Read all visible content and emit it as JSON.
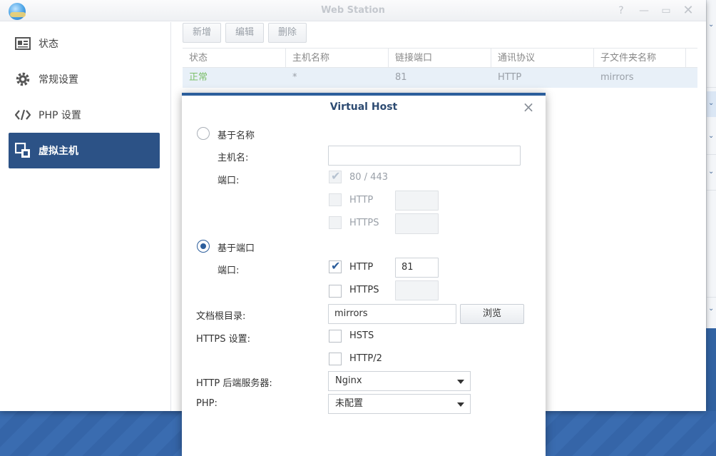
{
  "window": {
    "title": "Web Station"
  },
  "sidebar": {
    "items": [
      {
        "label": "状态",
        "icon": "status-icon"
      },
      {
        "label": "常规设置",
        "icon": "gear-icon"
      },
      {
        "label": "PHP 设置",
        "icon": "code-icon"
      },
      {
        "label": "虚拟主机",
        "icon": "virtual-host-icon",
        "active": true
      }
    ]
  },
  "toolbar": {
    "new_label": "新增",
    "edit_label": "编辑",
    "delete_label": "删除"
  },
  "table": {
    "columns": [
      "状态",
      "主机名称",
      "链接端口",
      "通讯协议",
      "子文件夹名称"
    ],
    "rows": [
      {
        "status": "正常",
        "hostname": "*",
        "port": "81",
        "protocol": "HTTP",
        "folder": "mirrors"
      }
    ]
  },
  "dialog": {
    "title": "Virtual Host",
    "name_based_label": "基于名称",
    "hostname_label": "主机名:",
    "hostname_value": "",
    "port_label": "端口:",
    "port_default_label": "80 / 443",
    "http_label": "HTTP",
    "https_label": "HTTPS",
    "port_based_label": "基于端口",
    "port_based_port_label": "端口:",
    "http_port_value": "81",
    "https_port_value": "",
    "docroot_label": "文档根目录:",
    "docroot_value": "mirrors",
    "browse_label": "浏览",
    "https_settings_label": "HTTPS 设置:",
    "hsts_label": "HSTS",
    "http2_label": "HTTP/2",
    "backend_label": "HTTP 后端服务器:",
    "backend_value": "Nginx",
    "php_label": "PHP:",
    "php_value": "未配置"
  },
  "colors": {
    "accent": "#2c5e9c",
    "active_nav": "#2c5286",
    "ok_status": "#7cbf6a"
  }
}
